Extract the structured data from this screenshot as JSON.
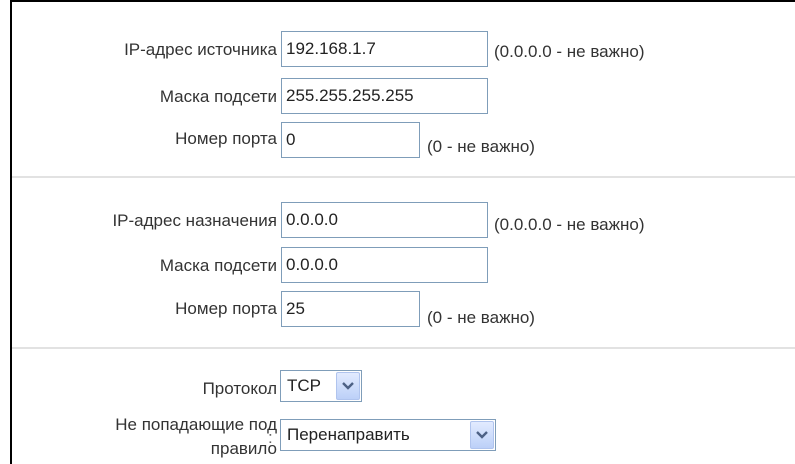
{
  "source": {
    "ip_label": "IP-адрес источника",
    "ip_value": "192.168.1.7",
    "ip_hint": "(0.0.0.0 - не важно)",
    "mask_label": "Маска подсети",
    "mask_value": "255.255.255.255",
    "port_label": "Номер порта",
    "port_value": "0",
    "port_hint": "(0 - не важно)"
  },
  "destination": {
    "ip_label": "IP-адрес назначения",
    "ip_value": "0.0.0.0",
    "ip_hint": "(0.0.0.0 - не важно)",
    "mask_label": "Маска подсети",
    "mask_value": "0.0.0.0",
    "port_label": "Номер порта",
    "port_value": "25",
    "port_hint": "(0 - не важно)"
  },
  "protocol": {
    "label": "Протокол",
    "value": "TCP"
  },
  "non_matching": {
    "label_line1": "Не попадающие под",
    "label_line2": "правило",
    "value": "Перенаправить"
  },
  "colon": ":",
  "icons": {
    "dropdown": "chevron-down-icon"
  }
}
